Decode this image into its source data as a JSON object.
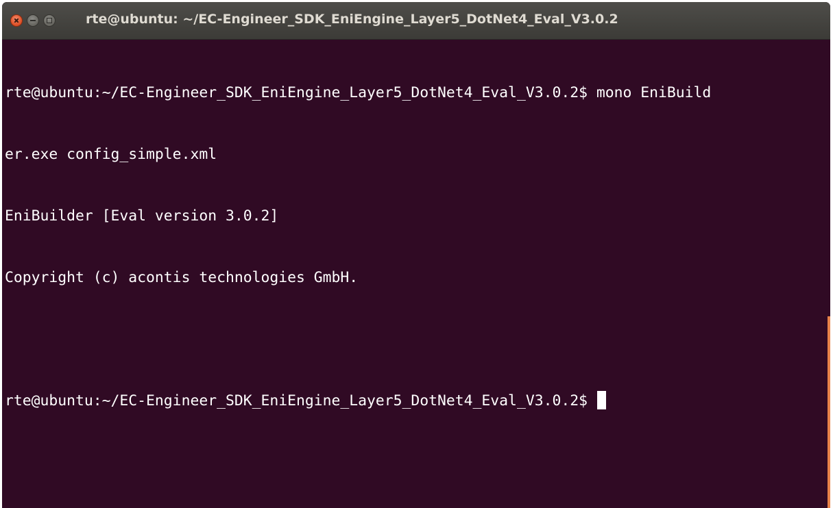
{
  "window": {
    "title": "rte@ubuntu: ~/EC-Engineer_SDK_EniEngine_Layer5_DotNet4_Eval_V3.0.2",
    "controls": {
      "close": "close-icon",
      "minimize": "minimize-icon",
      "maximize": "maximize-icon"
    }
  },
  "terminal": {
    "lines": [
      "rte@ubuntu:~/EC-Engineer_SDK_EniEngine_Layer5_DotNet4_Eval_V3.0.2$ mono EniBuild",
      "er.exe config_simple.xml",
      "EniBuilder [Eval version 3.0.2]",
      "Copyright (c) acontis technologies GmbH.",
      "",
      "rte@ubuntu:~/EC-Engineer_SDK_EniEngine_Layer5_DotNet4_Eval_V3.0.2$ "
    ]
  },
  "colors": {
    "background": "#300a24",
    "text": "#ffffff",
    "titlebar": "#3c3b37",
    "close_button": "#e0552c",
    "scroll_indicator": "#e8834a"
  }
}
